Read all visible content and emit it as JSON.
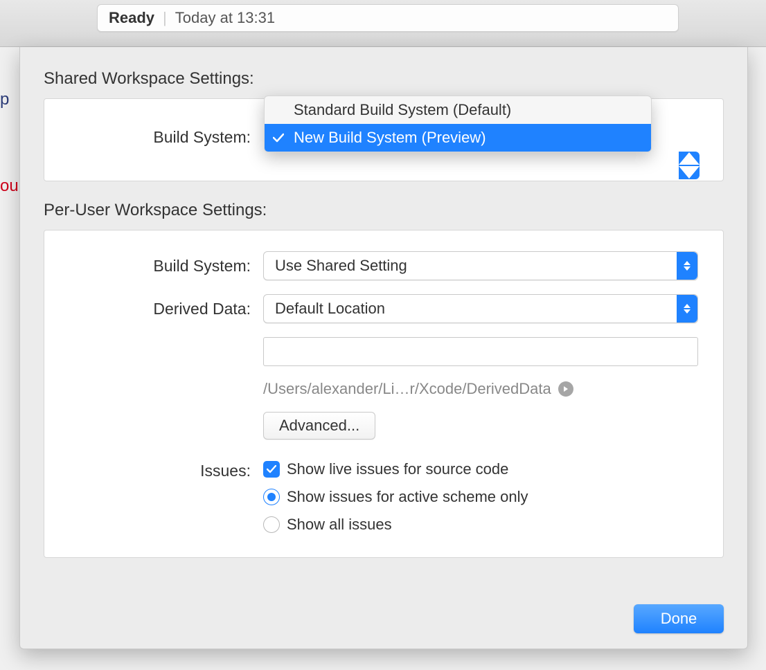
{
  "statusBar": {
    "ready": "Ready",
    "time": "Today at 13:31"
  },
  "backgroundSnippets": {
    "p": "p",
    "ou": "ou"
  },
  "shared": {
    "header": "Shared Workspace Settings:",
    "buildSystemLabel": "Build System:",
    "menu": {
      "option1": "Standard Build System (Default)",
      "option2": "New Build System (Preview)"
    }
  },
  "perUser": {
    "header": "Per-User Workspace Settings:",
    "buildSystemLabel": "Build System:",
    "buildSystemValue": "Use Shared Setting",
    "derivedDataLabel": "Derived Data:",
    "derivedDataValue": "Default Location",
    "derivedDataPath": "/Users/alexander/Li…r/Xcode/DerivedData",
    "advancedLabel": "Advanced...",
    "issuesLabel": "Issues:",
    "showLiveIssues": "Show live issues for source code",
    "radioActiveScheme": "Show issues for active scheme only",
    "radioAll": "Show all issues"
  },
  "doneLabel": "Done"
}
